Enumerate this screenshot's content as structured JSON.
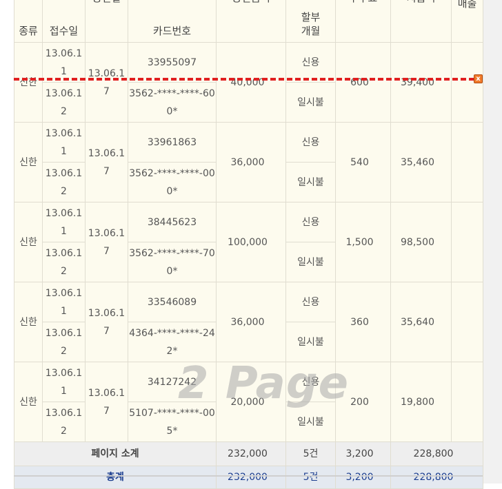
{
  "header": {
    "col_type": "종류",
    "col_receipt_date": "접수일",
    "col_approval_date": "승인일",
    "col_card_no": "카드번호",
    "col_approved_amount": "승인금액",
    "col_installment": "할부\n개월",
    "col_fee": "수수료",
    "col_deposit": "지급액",
    "col_sales": "매출"
  },
  "rows": [
    {
      "type": "신한",
      "receipt_date_1": "13.06.11",
      "receipt_date_2": "13.06.12",
      "approval_date": "13.06.17",
      "approval_no": "33955097",
      "card_no": "3562-****-****-600*",
      "amount": "40,000",
      "card_kind": "신용",
      "installment": "일시불",
      "fee": "600",
      "deposit": "39,400"
    },
    {
      "type": "신한",
      "receipt_date_1": "13.06.11",
      "receipt_date_2": "13.06.12",
      "approval_date": "13.06.17",
      "approval_no": "33961863",
      "card_no": "3562-****-****-000*",
      "amount": "36,000",
      "card_kind": "신용",
      "installment": "일시불",
      "fee": "540",
      "deposit": "35,460"
    },
    {
      "type": "신한",
      "receipt_date_1": "13.06.11",
      "receipt_date_2": "13.06.12",
      "approval_date": "13.06.17",
      "approval_no": "38445623",
      "card_no": "3562-****-****-700*",
      "amount": "100,000",
      "card_kind": "신용",
      "installment": "일시불",
      "fee": "1,500",
      "deposit": "98,500"
    },
    {
      "type": "신한",
      "receipt_date_1": "13.06.11",
      "receipt_date_2": "13.06.12",
      "approval_date": "13.06.17",
      "approval_no": "33546089",
      "card_no": "4364-****-****-242*",
      "amount": "36,000",
      "card_kind": "신용",
      "installment": "일시불",
      "fee": "360",
      "deposit": "35,640"
    },
    {
      "type": "신한",
      "receipt_date_1": "13.06.11",
      "receipt_date_2": "13.06.12",
      "approval_date": "13.06.17",
      "approval_no": "34127242",
      "card_no": "5107-****-****-005*",
      "amount": "20,000",
      "card_kind": "신용",
      "installment": "일시불",
      "fee": "200",
      "deposit": "19,800"
    }
  ],
  "subtotal": {
    "label": "페이지 소계",
    "amount": "232,000",
    "count": "5건",
    "fee": "3,200",
    "deposit": "228,800"
  },
  "total": {
    "label": "총계",
    "amount": "232,000",
    "count": "5건",
    "fee": "3,200",
    "deposit": "228,800"
  },
  "watermark": "2 Page",
  "page_break_remove_icon": "x"
}
